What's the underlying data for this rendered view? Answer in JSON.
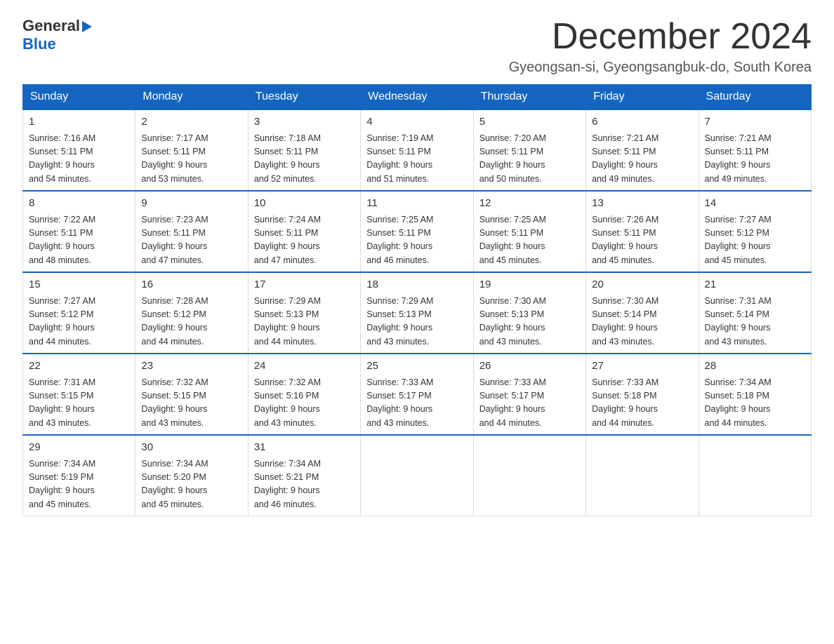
{
  "logo": {
    "general": "General",
    "arrow": "▶",
    "blue": "Blue"
  },
  "title": "December 2024",
  "subtitle": "Gyeongsan-si, Gyeongsangbuk-do, South Korea",
  "days_of_week": [
    "Sunday",
    "Monday",
    "Tuesday",
    "Wednesday",
    "Thursday",
    "Friday",
    "Saturday"
  ],
  "weeks": [
    [
      {
        "day": "1",
        "sunrise": "7:16 AM",
        "sunset": "5:11 PM",
        "daylight": "9 hours and 54 minutes."
      },
      {
        "day": "2",
        "sunrise": "7:17 AM",
        "sunset": "5:11 PM",
        "daylight": "9 hours and 53 minutes."
      },
      {
        "day": "3",
        "sunrise": "7:18 AM",
        "sunset": "5:11 PM",
        "daylight": "9 hours and 52 minutes."
      },
      {
        "day": "4",
        "sunrise": "7:19 AM",
        "sunset": "5:11 PM",
        "daylight": "9 hours and 51 minutes."
      },
      {
        "day": "5",
        "sunrise": "7:20 AM",
        "sunset": "5:11 PM",
        "daylight": "9 hours and 50 minutes."
      },
      {
        "day": "6",
        "sunrise": "7:21 AM",
        "sunset": "5:11 PM",
        "daylight": "9 hours and 49 minutes."
      },
      {
        "day": "7",
        "sunrise": "7:21 AM",
        "sunset": "5:11 PM",
        "daylight": "9 hours and 49 minutes."
      }
    ],
    [
      {
        "day": "8",
        "sunrise": "7:22 AM",
        "sunset": "5:11 PM",
        "daylight": "9 hours and 48 minutes."
      },
      {
        "day": "9",
        "sunrise": "7:23 AM",
        "sunset": "5:11 PM",
        "daylight": "9 hours and 47 minutes."
      },
      {
        "day": "10",
        "sunrise": "7:24 AM",
        "sunset": "5:11 PM",
        "daylight": "9 hours and 47 minutes."
      },
      {
        "day": "11",
        "sunrise": "7:25 AM",
        "sunset": "5:11 PM",
        "daylight": "9 hours and 46 minutes."
      },
      {
        "day": "12",
        "sunrise": "7:25 AM",
        "sunset": "5:11 PM",
        "daylight": "9 hours and 45 minutes."
      },
      {
        "day": "13",
        "sunrise": "7:26 AM",
        "sunset": "5:11 PM",
        "daylight": "9 hours and 45 minutes."
      },
      {
        "day": "14",
        "sunrise": "7:27 AM",
        "sunset": "5:12 PM",
        "daylight": "9 hours and 45 minutes."
      }
    ],
    [
      {
        "day": "15",
        "sunrise": "7:27 AM",
        "sunset": "5:12 PM",
        "daylight": "9 hours and 44 minutes."
      },
      {
        "day": "16",
        "sunrise": "7:28 AM",
        "sunset": "5:12 PM",
        "daylight": "9 hours and 44 minutes."
      },
      {
        "day": "17",
        "sunrise": "7:29 AM",
        "sunset": "5:13 PM",
        "daylight": "9 hours and 44 minutes."
      },
      {
        "day": "18",
        "sunrise": "7:29 AM",
        "sunset": "5:13 PM",
        "daylight": "9 hours and 43 minutes."
      },
      {
        "day": "19",
        "sunrise": "7:30 AM",
        "sunset": "5:13 PM",
        "daylight": "9 hours and 43 minutes."
      },
      {
        "day": "20",
        "sunrise": "7:30 AM",
        "sunset": "5:14 PM",
        "daylight": "9 hours and 43 minutes."
      },
      {
        "day": "21",
        "sunrise": "7:31 AM",
        "sunset": "5:14 PM",
        "daylight": "9 hours and 43 minutes."
      }
    ],
    [
      {
        "day": "22",
        "sunrise": "7:31 AM",
        "sunset": "5:15 PM",
        "daylight": "9 hours and 43 minutes."
      },
      {
        "day": "23",
        "sunrise": "7:32 AM",
        "sunset": "5:15 PM",
        "daylight": "9 hours and 43 minutes."
      },
      {
        "day": "24",
        "sunrise": "7:32 AM",
        "sunset": "5:16 PM",
        "daylight": "9 hours and 43 minutes."
      },
      {
        "day": "25",
        "sunrise": "7:33 AM",
        "sunset": "5:17 PM",
        "daylight": "9 hours and 43 minutes."
      },
      {
        "day": "26",
        "sunrise": "7:33 AM",
        "sunset": "5:17 PM",
        "daylight": "9 hours and 44 minutes."
      },
      {
        "day": "27",
        "sunrise": "7:33 AM",
        "sunset": "5:18 PM",
        "daylight": "9 hours and 44 minutes."
      },
      {
        "day": "28",
        "sunrise": "7:34 AM",
        "sunset": "5:18 PM",
        "daylight": "9 hours and 44 minutes."
      }
    ],
    [
      {
        "day": "29",
        "sunrise": "7:34 AM",
        "sunset": "5:19 PM",
        "daylight": "9 hours and 45 minutes."
      },
      {
        "day": "30",
        "sunrise": "7:34 AM",
        "sunset": "5:20 PM",
        "daylight": "9 hours and 45 minutes."
      },
      {
        "day": "31",
        "sunrise": "7:34 AM",
        "sunset": "5:21 PM",
        "daylight": "9 hours and 46 minutes."
      },
      null,
      null,
      null,
      null
    ]
  ]
}
